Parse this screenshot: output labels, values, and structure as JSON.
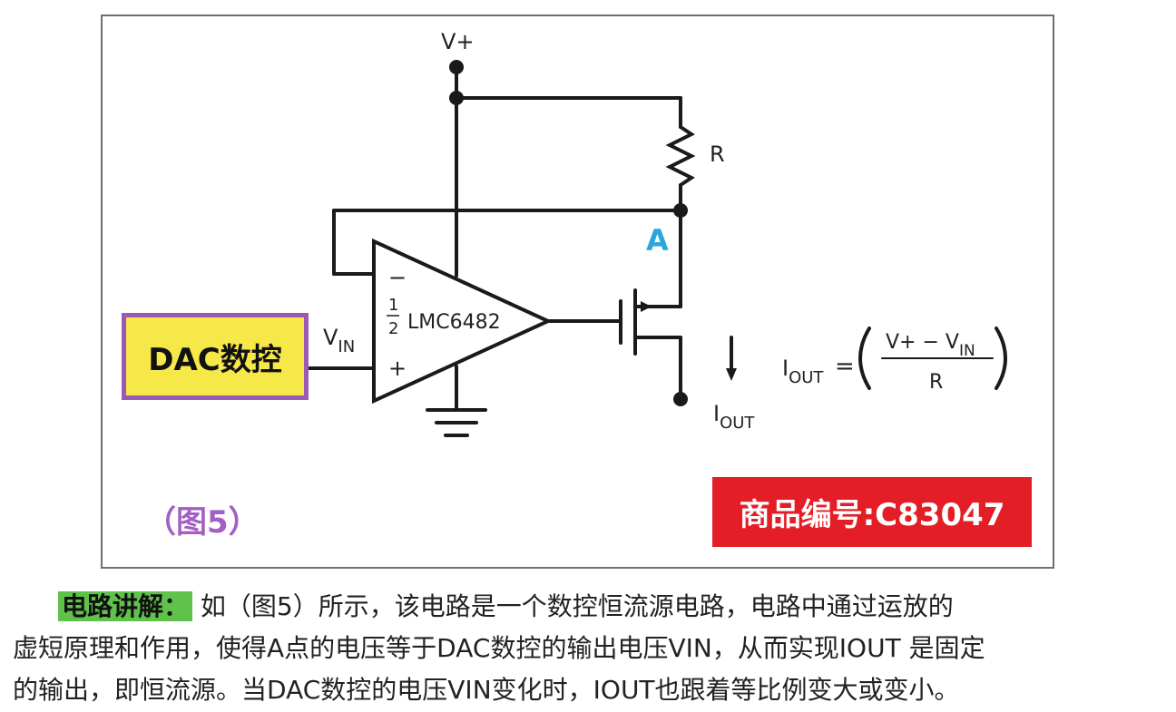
{
  "diagram": {
    "supply_label": "V+",
    "resistor_label": "R",
    "node_label": "A",
    "opamp_minus": "−",
    "opamp_half_num": "1",
    "opamp_half_den": "2",
    "opamp_name": "LMC6482",
    "opamp_plus": "+",
    "vin_label_main": "V",
    "vin_label_sub": "IN",
    "iout_label_main": "I",
    "iout_label_sub": "OUT",
    "formula_lhs_main": "I",
    "formula_lhs_sub": "OUT",
    "formula_eq": "=",
    "formula_num_left": "V+  −  V",
    "formula_num_sub": "IN",
    "formula_den": "R",
    "dac_label": "DAC数控",
    "figure_caption": "（图5）",
    "item_badge": "商品编号:C83047",
    "node_color": "#2aa6dc",
    "dac_border_color": "#9b59b6",
    "dac_fill_color": "#f7e84a",
    "badge_color": "#e31e26"
  },
  "explanation": {
    "heading": "电路讲解：",
    "line1": "如（图5）所示，该电路是一个数控恒流源电路，电路中通过运放的",
    "line2": "虚短原理和作用，使得A点的电压等于DAC数控的输出电压VIN，从而实现IOUT 是固定",
    "line3": "的输出，即恒流源。当DAC数控的电压VIN变化时，IOUT也跟着等比例变大或变小。"
  }
}
